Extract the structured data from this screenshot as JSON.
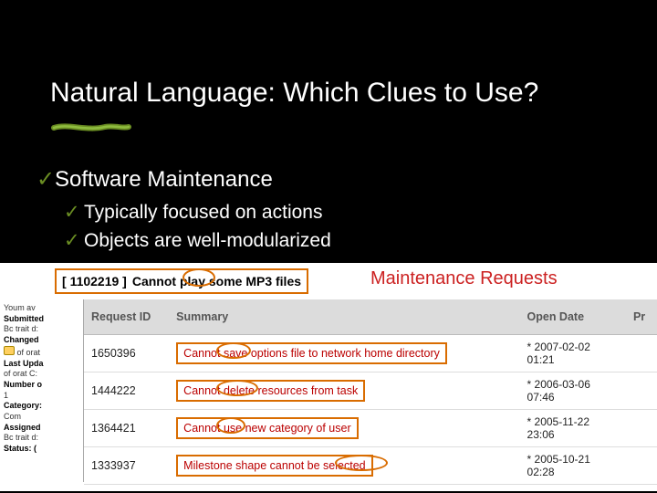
{
  "title": "Natural Language: Which Clues to Use?",
  "bullets": {
    "main": "Software Maintenance",
    "sub1": "Typically focused on actions",
    "sub2": "Objects are well-modularized"
  },
  "bug": {
    "id": "1102219",
    "title": "Cannot play some MP3 files"
  },
  "mr_label": "Maintenance Requests",
  "table": {
    "headers": {
      "id": "Request ID",
      "summary": "Summary",
      "open": "Open Date",
      "pr": "Pr"
    },
    "rows": [
      {
        "id": "1650396",
        "summary": "Cannot save options file to network home directory",
        "open": "* 2007-02-02\n01:21"
      },
      {
        "id": "1444222",
        "summary": "Cannot delete resources from task",
        "open": "* 2006-03-06\n07:46"
      },
      {
        "id": "1364421",
        "summary": "Cannot use new category of user",
        "open": "* 2005-11-22\n23:06"
      },
      {
        "id": "1333937",
        "summary": "Milestone shape cannot be selected",
        "open": "* 2005-10-21\n02:28"
      }
    ]
  },
  "frag": {
    "l1": "Youm av",
    "l2": "Submitted",
    "l3": "Bc trait d:",
    "l4": "Changed",
    "l5": "of orat",
    "l6": "Last Upda",
    "l7": "of orat C:",
    "l8": "Number o",
    "l9": "1",
    "l10": "Category:",
    "l11": "Com",
    "l12": "Assigned",
    "l13": "Bc trait d:",
    "l14": "Status: ("
  }
}
